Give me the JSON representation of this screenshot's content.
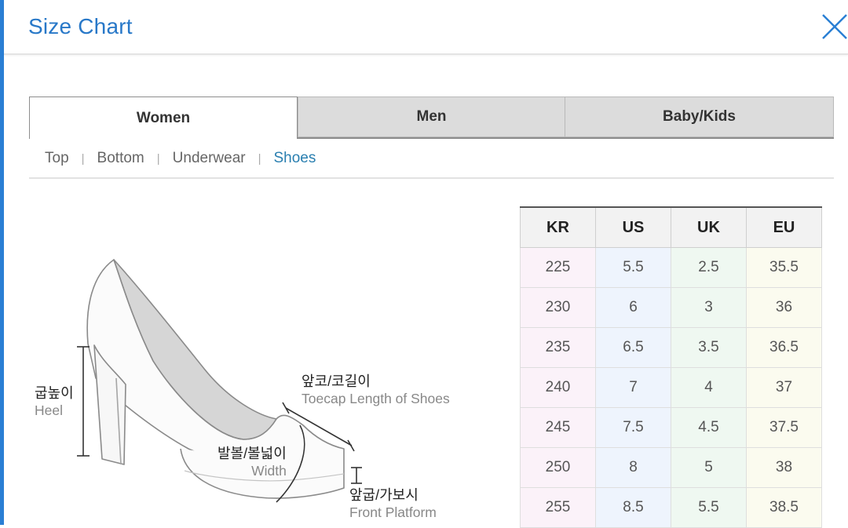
{
  "header": {
    "title": "Size Chart"
  },
  "tabs": [
    {
      "label": "Women"
    },
    {
      "label": "Men"
    },
    {
      "label": "Baby/Kids"
    }
  ],
  "subnav": [
    {
      "label": "Top"
    },
    {
      "label": "Bottom"
    },
    {
      "label": "Underwear"
    },
    {
      "label": "Shoes"
    }
  ],
  "diagram": {
    "heel_ko": "굽높이",
    "heel_en": "Heel",
    "toecap_ko": "앞코/코길이",
    "toecap_en": "Toecap Length of Shoes",
    "width_ko": "발볼/볼넓이",
    "width_en": "Width",
    "platform_ko": "앞굽/가보시",
    "platform_en": "Front Platform"
  },
  "table": {
    "headers": [
      "KR",
      "US",
      "UK",
      "EU"
    ],
    "rows": [
      [
        "225",
        "5.5",
        "2.5",
        "35.5"
      ],
      [
        "230",
        "6",
        "3",
        "36"
      ],
      [
        "235",
        "6.5",
        "3.5",
        "36.5"
      ],
      [
        "240",
        "7",
        "4",
        "37"
      ],
      [
        "245",
        "7.5",
        "4.5",
        "37.5"
      ],
      [
        "250",
        "8",
        "5",
        "38"
      ],
      [
        "255",
        "8.5",
        "5.5",
        "38.5"
      ]
    ]
  },
  "colors": {
    "accent": "#2878c8",
    "kr_col": "#fbf2f9",
    "us_col": "#eef4fd",
    "uk_col": "#eff8f1",
    "eu_col": "#fbfbef"
  },
  "icons": {
    "close": "close-icon"
  }
}
